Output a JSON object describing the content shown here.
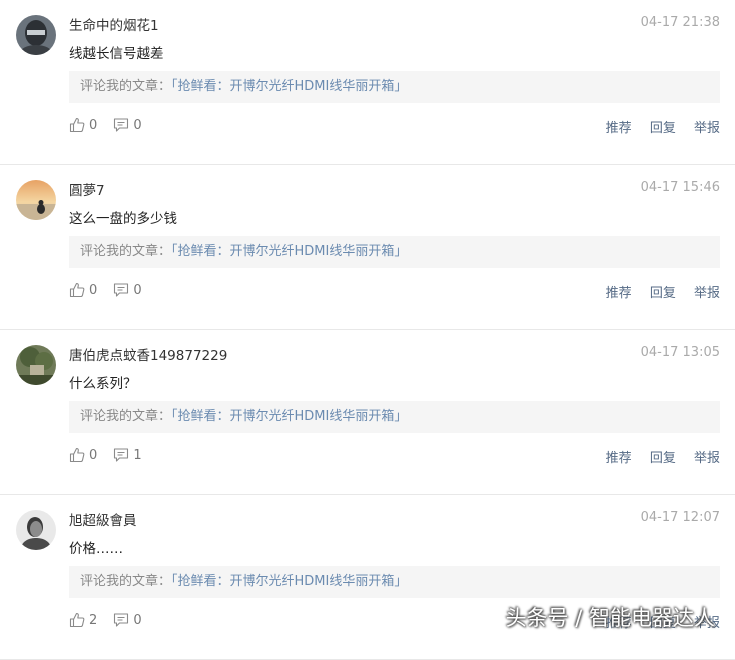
{
  "comments": [
    {
      "username": "生命中的烟花1",
      "time": "04-17 21:38",
      "content": "线越长信号越差",
      "quote_prefix": "评论我的文章：",
      "quote_link": "「抢鲜看：开博尔光纤HDMI线华丽开箱」",
      "likes": "0",
      "replies": "0",
      "actions": {
        "recommend": "推荐",
        "reply": "回复",
        "report": "举报"
      }
    },
    {
      "username": "圓夢7",
      "time": "04-17 15:46",
      "content": "这么一盘的多少钱",
      "quote_prefix": "评论我的文章：",
      "quote_link": "「抢鲜看：开博尔光纤HDMI线华丽开箱」",
      "likes": "0",
      "replies": "0",
      "actions": {
        "recommend": "推荐",
        "reply": "回复",
        "report": "举报"
      }
    },
    {
      "username": "唐伯虎点蚊香149877229",
      "time": "04-17 13:05",
      "content": "什么系列？",
      "quote_prefix": "评论我的文章：",
      "quote_link": "「抢鲜看：开博尔光纤HDMI线华丽开箱」",
      "likes": "0",
      "replies": "1",
      "actions": {
        "recommend": "推荐",
        "reply": "回复",
        "report": "举报"
      }
    },
    {
      "username": "旭超級會員",
      "time": "04-17 12:07",
      "content": "价格……",
      "quote_prefix": "评论我的文章：",
      "quote_link": "「抢鲜看：开博尔光纤HDMI线华丽开箱」",
      "likes": "2",
      "replies": "0",
      "actions": {
        "recommend": "推荐",
        "reply": "回复",
        "report": "举报"
      }
    }
  ],
  "watermark": "头条号 / 智能电器达人",
  "colors": {
    "link": "#6b8bb0",
    "action": "#556a85",
    "quote_bg": "#f5f5f5",
    "time": "#aaaaaa"
  }
}
